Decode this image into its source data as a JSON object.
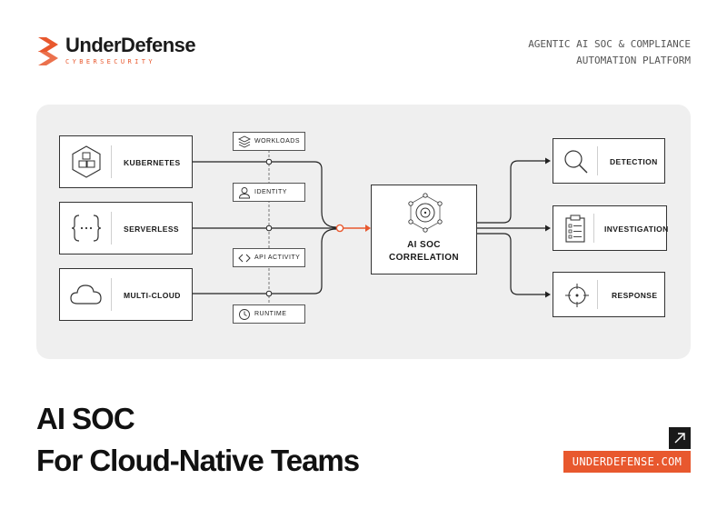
{
  "brand": {
    "name": "UnderDefense",
    "subtitle": "CYBERSECURITY",
    "accent": "#e8582e"
  },
  "tagline": {
    "line1": "AGENTIC AI SOC & COMPLIANCE",
    "line2": "AUTOMATION PLATFORM"
  },
  "diagram": {
    "sources": [
      {
        "label": "KUBERNETES",
        "icon": "kubernetes-cubes-icon"
      },
      {
        "label": "SERVERLESS",
        "icon": "braces-icon"
      },
      {
        "label": "MULTI-CLOUD",
        "icon": "cloud-icon"
      }
    ],
    "signals": [
      {
        "label": "WORKLOADS",
        "icon": "layers-icon"
      },
      {
        "label": "IDENTITY",
        "icon": "user-icon"
      },
      {
        "label": "API ACTIVITY",
        "icon": "code-icon"
      },
      {
        "label": "RUNTIME",
        "icon": "clock-icon"
      }
    ],
    "core": {
      "line1": "AI SOC",
      "line2": "CORRELATION",
      "icon": "network-hub-icon"
    },
    "outputs": [
      {
        "label": "DETECTION",
        "icon": "magnifier-icon"
      },
      {
        "label": "INVESTIGATION",
        "icon": "clipboard-icon"
      },
      {
        "label": "RESPONSE",
        "icon": "crosshair-icon"
      }
    ]
  },
  "headline": {
    "line1": "AI SOC",
    "line2": "For Cloud-Native Teams"
  },
  "cta": {
    "url": "UNDERDEFENSE.COM",
    "icon": "arrow-up-right-icon"
  }
}
